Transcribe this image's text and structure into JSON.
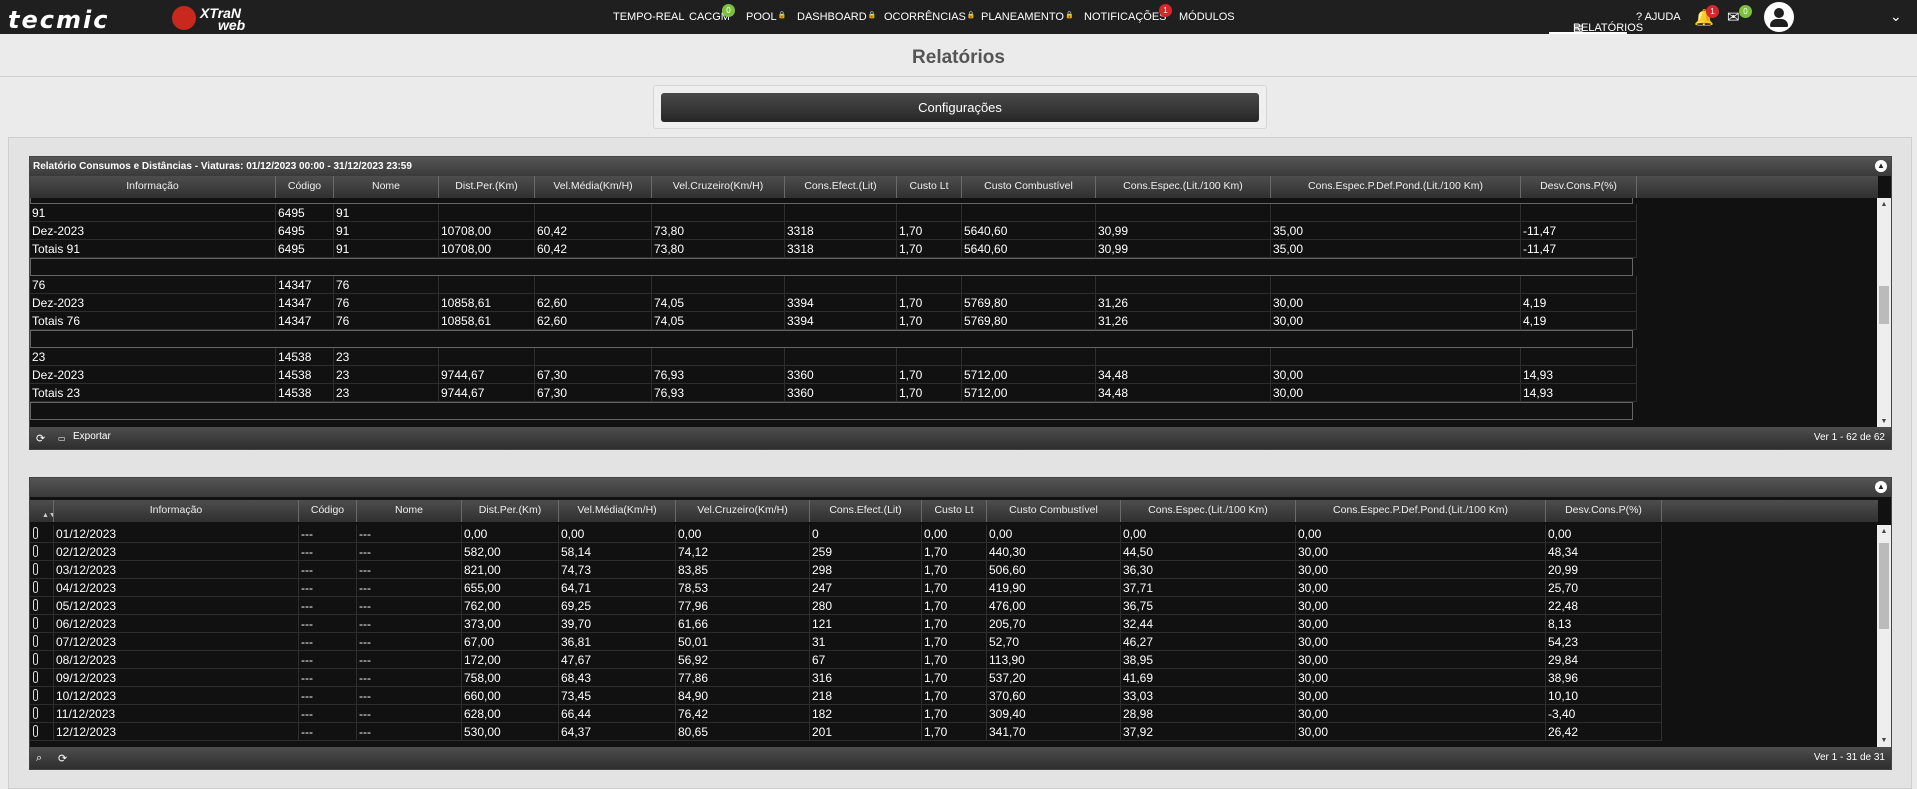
{
  "brand": {
    "logo_text": "tecmic",
    "product_line1": "XTraN",
    "product_line2": "web"
  },
  "nav": {
    "items": [
      {
        "label": "TEMPO-REAL"
      },
      {
        "label": "CACGM",
        "badge": "0"
      },
      {
        "label": "POOL"
      },
      {
        "label": "DASHBOARD"
      },
      {
        "label": "OCORRÊNCIAS"
      },
      {
        "label": "PLANEAMENTO"
      },
      {
        "label": "NOTIFICAÇÕES",
        "badge": "1"
      },
      {
        "label": "MÓDULOS"
      }
    ],
    "reports": "RELATÓRIOS",
    "help": "AJUDA",
    "alerts_badge": "1",
    "messages_badge": "0"
  },
  "page": {
    "title": "Relatórios",
    "config_button": "Configurações"
  },
  "grid1": {
    "caption": "Relatório Consumos e Distâncias - Viaturas: 01/12/2023 00:00 - 31/12/2023 23:59",
    "columns": [
      "Informação",
      "Código",
      "Nome",
      "Dist.Per.(Km)",
      "Vel.Média(Km/H)",
      "Vel.Cruzeiro(Km/H)",
      "Cons.Efect.(Lit)",
      "Custo Lt",
      "Custo Combustível",
      "Cons.Espec.(Lit./100 Km)",
      "Cons.Espec.P.Def.Pond.(Lit./100 Km)",
      "Desv.Cons.P(%)"
    ],
    "rows": [
      [
        "91",
        "6495",
        "91",
        "",
        "",
        "",
        "",
        "",
        "",
        "",
        "",
        ""
      ],
      [
        "Dez-2023",
        "6495",
        "91",
        "10708,00",
        "60,42",
        "73,80",
        "3318",
        "1,70",
        "5640,60",
        "30,99",
        "35,00",
        "-11,47"
      ],
      [
        "Totais 91",
        "6495",
        "91",
        "10708,00",
        "60,42",
        "73,80",
        "3318",
        "1,70",
        "5640,60",
        "30,99",
        "35,00",
        "-11,47"
      ],
      [
        "76",
        "14347",
        "76",
        "",
        "",
        "",
        "",
        "",
        "",
        "",
        "",
        ""
      ],
      [
        "Dez-2023",
        "14347",
        "76",
        "10858,61",
        "62,60",
        "74,05",
        "3394",
        "1,70",
        "5769,80",
        "31,26",
        "30,00",
        "4,19"
      ],
      [
        "Totais 76",
        "14347",
        "76",
        "10858,61",
        "62,60",
        "74,05",
        "3394",
        "1,70",
        "5769,80",
        "31,26",
        "30,00",
        "4,19"
      ],
      [
        "23",
        "14538",
        "23",
        "",
        "",
        "",
        "",
        "",
        "",
        "",
        "",
        ""
      ],
      [
        "Dez-2023",
        "14538",
        "23",
        "9744,67",
        "67,30",
        "76,93",
        "3360",
        "1,70",
        "5712,00",
        "34,48",
        "30,00",
        "14,93"
      ],
      [
        "Totais 23",
        "14538",
        "23",
        "9744,67",
        "67,30",
        "76,93",
        "3360",
        "1,70",
        "5712,00",
        "34,48",
        "30,00",
        "14,93"
      ]
    ],
    "export_label": "Exportar",
    "pager_info": "Ver 1 - 62 de 62"
  },
  "grid2": {
    "columns": [
      "Informação",
      "Código",
      "Nome",
      "Dist.Per.(Km)",
      "Vel.Média(Km/H)",
      "Vel.Cruzeiro(Km/H)",
      "Cons.Efect.(Lit)",
      "Custo Lt",
      "Custo Combustível",
      "Cons.Espec.(Lit./100 Km)",
      "Cons.Espec.P.Def.Pond.(Lit./100 Km)",
      "Desv.Cons.P(%)"
    ],
    "rows": [
      [
        "01/12/2023",
        "---",
        "---",
        "0,00",
        "0,00",
        "0,00",
        "0",
        "0,00",
        "0,00",
        "0,00",
        "0,00",
        "0,00"
      ],
      [
        "02/12/2023",
        "---",
        "---",
        "582,00",
        "58,14",
        "74,12",
        "259",
        "1,70",
        "440,30",
        "44,50",
        "30,00",
        "48,34"
      ],
      [
        "03/12/2023",
        "---",
        "---",
        "821,00",
        "74,73",
        "83,85",
        "298",
        "1,70",
        "506,60",
        "36,30",
        "30,00",
        "20,99"
      ],
      [
        "04/12/2023",
        "---",
        "---",
        "655,00",
        "64,71",
        "78,53",
        "247",
        "1,70",
        "419,90",
        "37,71",
        "30,00",
        "25,70"
      ],
      [
        "05/12/2023",
        "---",
        "---",
        "762,00",
        "69,25",
        "77,96",
        "280",
        "1,70",
        "476,00",
        "36,75",
        "30,00",
        "22,48"
      ],
      [
        "06/12/2023",
        "---",
        "---",
        "373,00",
        "39,70",
        "61,66",
        "121",
        "1,70",
        "205,70",
        "32,44",
        "30,00",
        "8,13"
      ],
      [
        "07/12/2023",
        "---",
        "---",
        "67,00",
        "36,81",
        "50,01",
        "31",
        "1,70",
        "52,70",
        "46,27",
        "30,00",
        "54,23"
      ],
      [
        "08/12/2023",
        "---",
        "---",
        "172,00",
        "47,67",
        "56,92",
        "67",
        "1,70",
        "113,90",
        "38,95",
        "30,00",
        "29,84"
      ],
      [
        "09/12/2023",
        "---",
        "---",
        "758,00",
        "68,43",
        "77,86",
        "316",
        "1,70",
        "537,20",
        "41,69",
        "30,00",
        "38,96"
      ],
      [
        "10/12/2023",
        "---",
        "---",
        "660,00",
        "73,45",
        "84,90",
        "218",
        "1,70",
        "370,60",
        "33,03",
        "30,00",
        "10,10"
      ],
      [
        "11/12/2023",
        "---",
        "---",
        "628,00",
        "66,44",
        "76,42",
        "182",
        "1,70",
        "309,40",
        "28,98",
        "30,00",
        "-3,40"
      ],
      [
        "12/12/2023",
        "---",
        "---",
        "530,00",
        "64,37",
        "80,65",
        "201",
        "1,70",
        "341,70",
        "37,92",
        "30,00",
        "26,42"
      ]
    ],
    "pager_info": "Ver 1 - 31 de 31"
  }
}
